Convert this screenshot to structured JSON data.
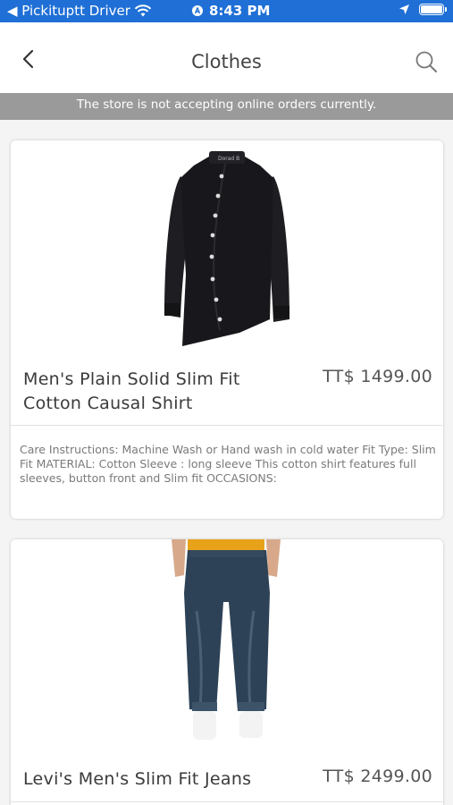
{
  "status_bar": {
    "back_app": "◀ Pickituptt Driver",
    "time": "8:43 PM",
    "battery_level": 1.0
  },
  "header": {
    "title": "Clothes",
    "back_icon": "chevron-left-icon",
    "search_icon": "search-icon"
  },
  "notice": {
    "text": "The store is not accepting online orders currently."
  },
  "products": [
    {
      "name": "Men's Plain Solid Slim Fit Cotton Causal Shirt",
      "price": "TT$ 1499.00",
      "description": "Care Instructions: Machine Wash or Hand wash in cold water Fit Type: Slim Fit MATERIAL: Cotton Sleeve : long sleeve This cotton shirt features full sleeves, button front and Slim fit OCCASIONS:"
    },
    {
      "name": "Levi's Men's Slim Fit Jeans",
      "price": "TT$ 2499.00"
    }
  ],
  "colors": {
    "status_bar": "#1f6fd6",
    "notice_bg": "#9a9a9a",
    "page_bg": "#f4f4f4"
  }
}
